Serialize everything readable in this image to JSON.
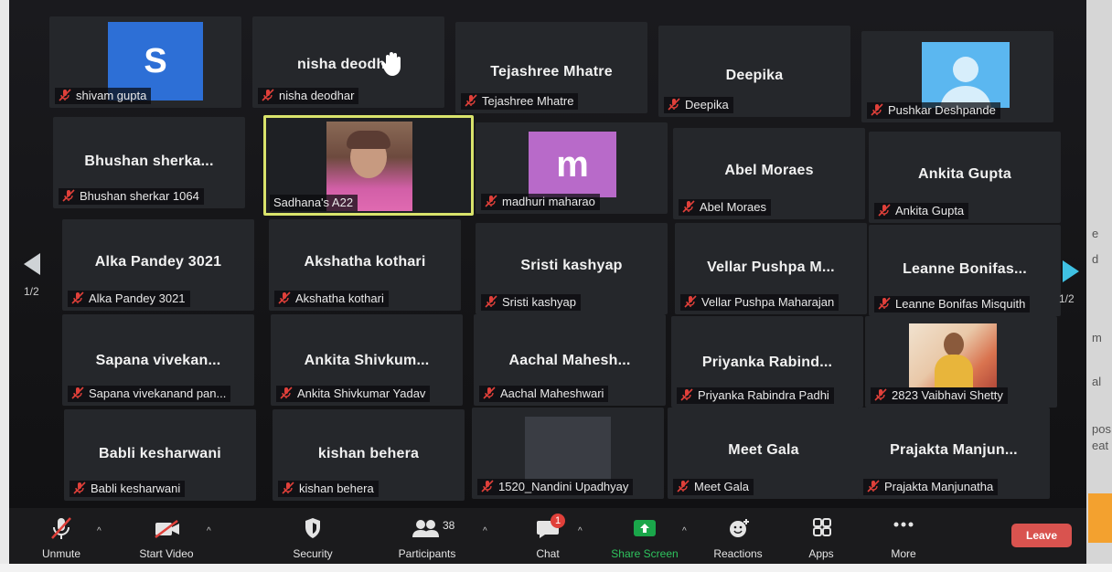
{
  "pagination": {
    "left": "1/2",
    "right": "1/2"
  },
  "tiles": [
    {
      "name": "shivam gupta",
      "big": "",
      "avatar_letter": "S",
      "avatar_color": "#2d6fd6"
    },
    {
      "name": "nisha deodhar",
      "big": "nisha deodhar"
    },
    {
      "name": "Tejashree Mhatre",
      "big": "Tejashree Mhatre"
    },
    {
      "name": "Deepika",
      "big": "Deepika"
    },
    {
      "name": "Pushkar Deshpande",
      "big": ""
    },
    {
      "name": "Bhushan sherkar 1064",
      "big": "Bhushan sherka..."
    },
    {
      "name": "Sadhana's A22",
      "big": ""
    },
    {
      "name": "madhuri maharao",
      "big": "",
      "avatar_letter": "m",
      "avatar_color": "#b86ac9"
    },
    {
      "name": "Abel Moraes",
      "big": "Abel Moraes"
    },
    {
      "name": "Ankita Gupta",
      "big": "Ankita Gupta"
    },
    {
      "name": "Alka Pandey 3021",
      "big": "Alka Pandey 3021"
    },
    {
      "name": "Akshatha kothari",
      "big": "Akshatha kothari"
    },
    {
      "name": "Sristi kashyap",
      "big": "Sristi kashyap"
    },
    {
      "name": "Vellar Pushpa Maharajan",
      "big": "Vellar Pushpa M..."
    },
    {
      "name": "Leanne Bonifas Misquith",
      "big": "Leanne Bonifas..."
    },
    {
      "name": "Sapana vivekanand pan...",
      "big": "Sapana vivekan..."
    },
    {
      "name": "Ankita Shivkumar Yadav",
      "big": "Ankita Shivkum..."
    },
    {
      "name": "Aachal Maheshwari",
      "big": "Aachal Mahesh..."
    },
    {
      "name": "Priyanka Rabindra Padhi",
      "big": "Priyanka Rabind..."
    },
    {
      "name": "2823 Vaibhavi Shetty",
      "big": ""
    },
    {
      "name": "Babli kesharwani",
      "big": "Babli kesharwani"
    },
    {
      "name": "kishan behera",
      "big": "kishan behera"
    },
    {
      "name": "1520_Nandini Upadhyay",
      "big": ""
    },
    {
      "name": "Meet Gala",
      "big": "Meet Gala"
    },
    {
      "name": "Prajakta Manjunatha",
      "big": "Prajakta Manjun..."
    }
  ],
  "toolbar": {
    "unmute": "Unmute",
    "start_video": "Start Video",
    "security": "Security",
    "participants": "Participants",
    "participants_count": "38",
    "chat": "Chat",
    "chat_badge": "1",
    "share_screen": "Share Screen",
    "reactions": "Reactions",
    "apps": "Apps",
    "more": "More",
    "leave": "Leave"
  },
  "colors": {
    "active_speaker": "#d9e36b",
    "share_screen_green": "#1aa64a",
    "leave_red": "#d9534f",
    "muted_red": "#e0403a"
  },
  "right_edge_snippets": [
    "e",
    "d",
    "m",
    "al",
    "pos",
    "eat"
  ]
}
